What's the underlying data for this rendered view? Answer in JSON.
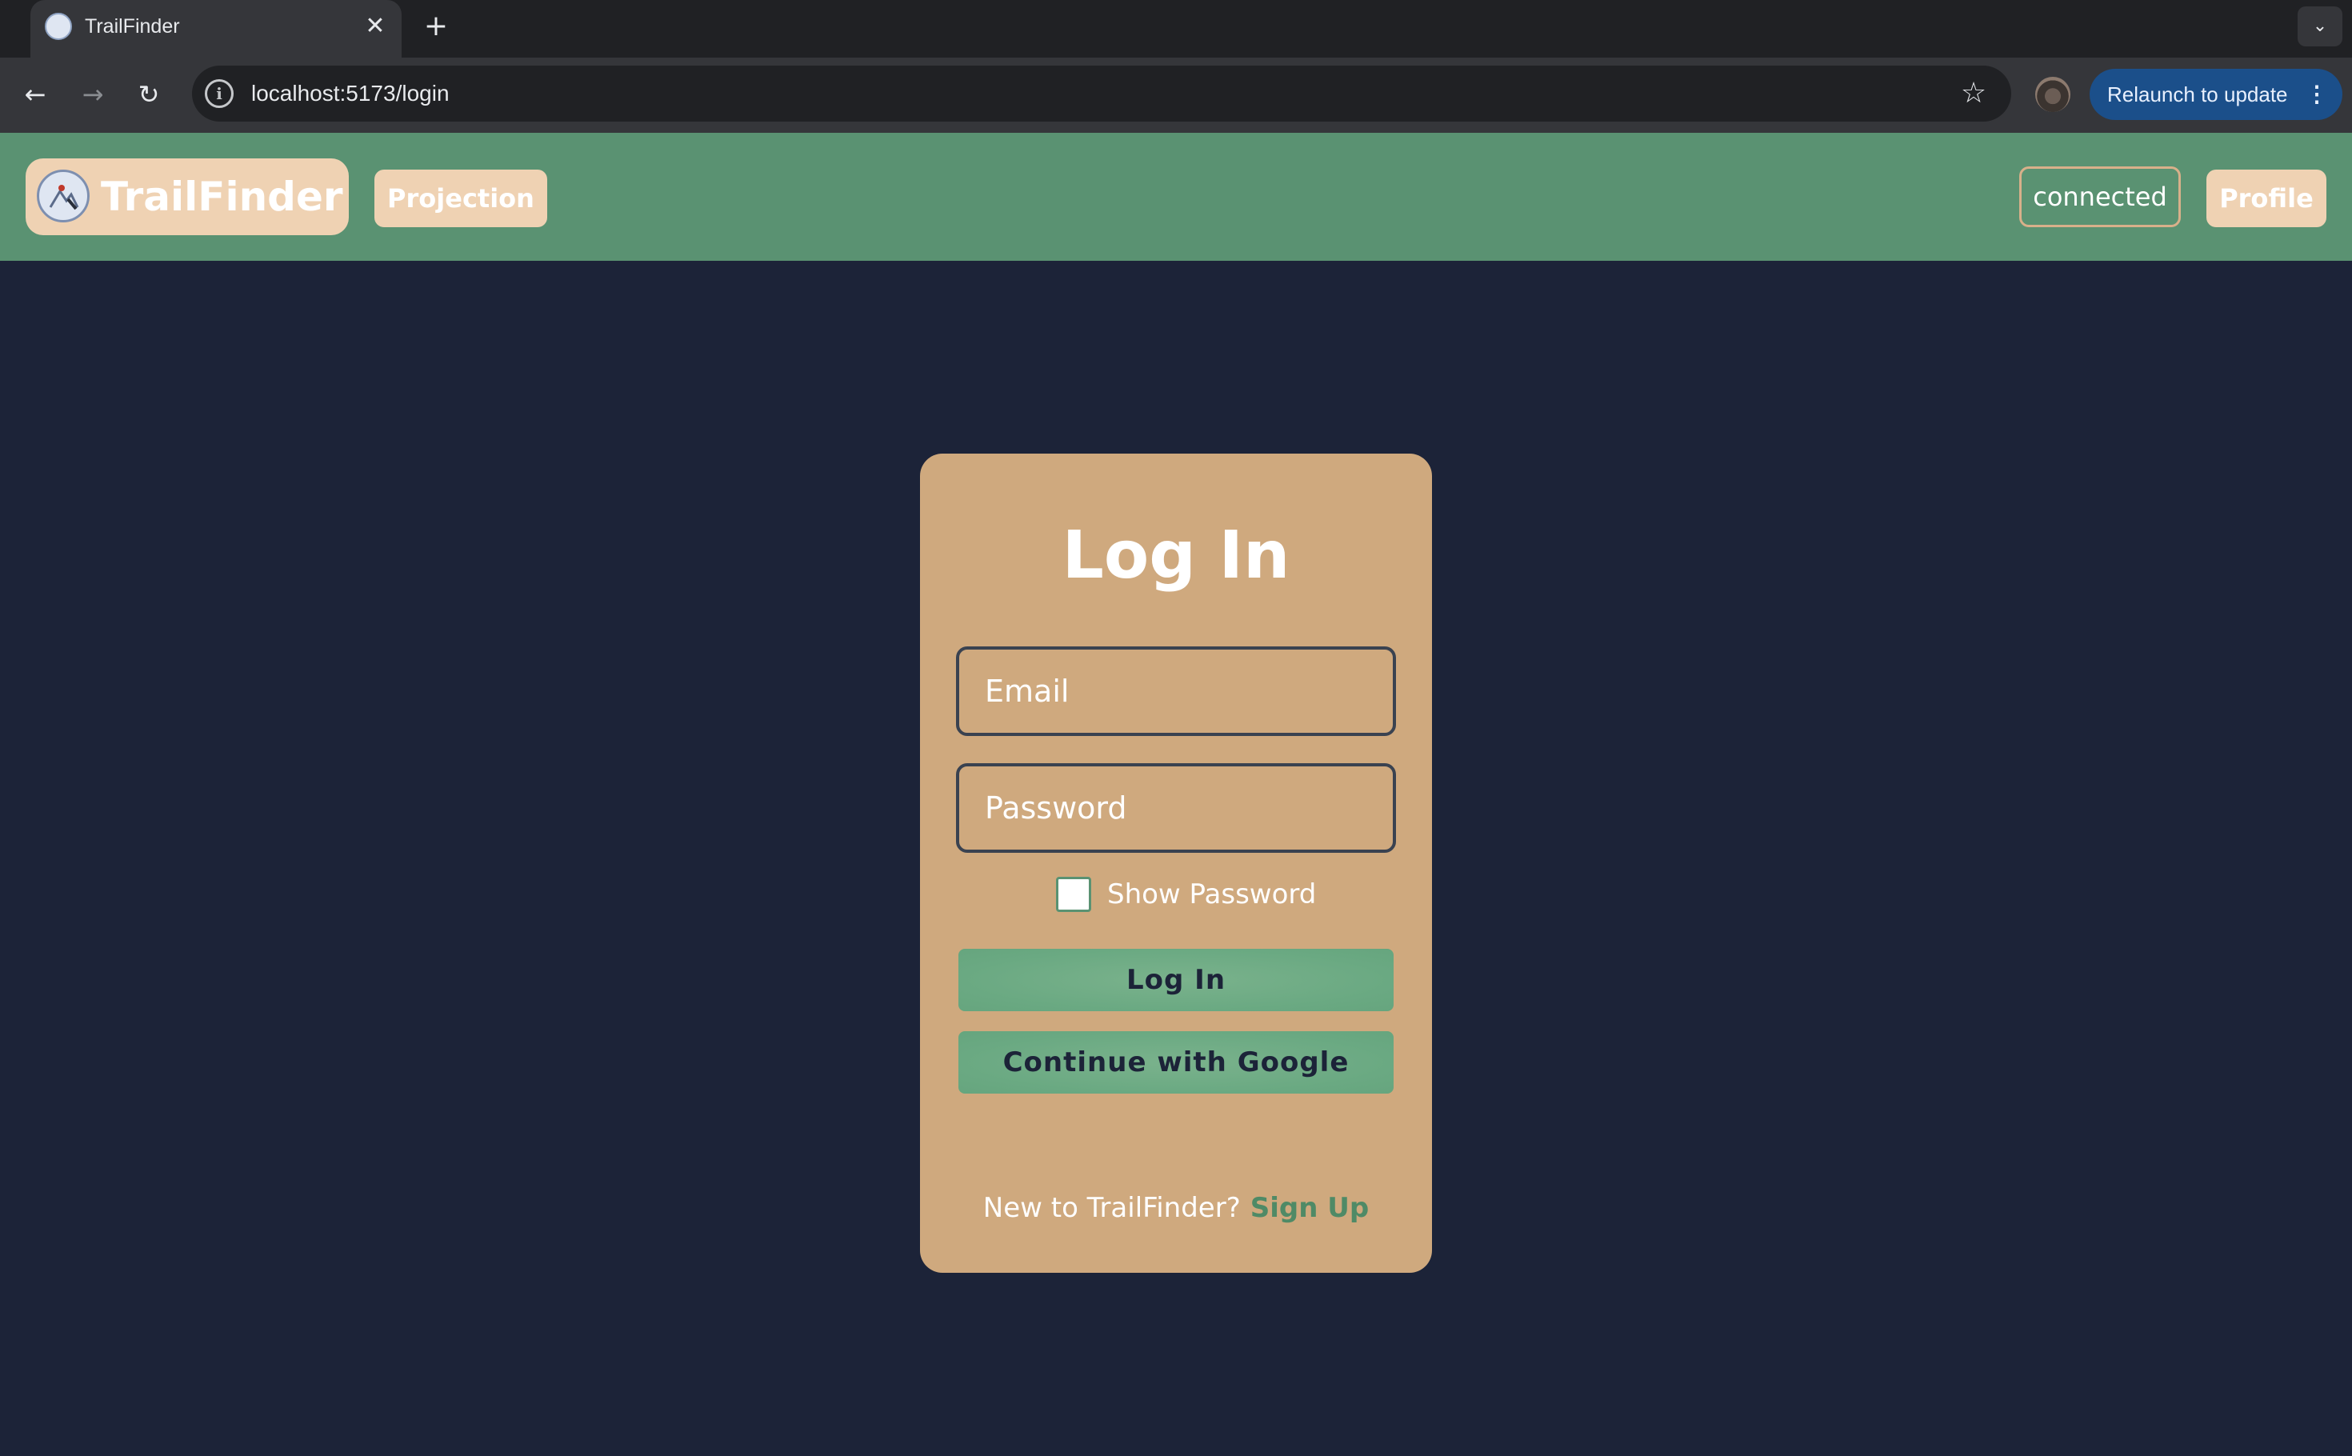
{
  "browser": {
    "tab_title": "TrailFinder",
    "tab_close": "✕",
    "new_tab": "+",
    "tab_search": "⌄",
    "back": "←",
    "forward": "→",
    "reload": "↻",
    "url": "localhost:5173/login",
    "info_icon": "i",
    "star": "☆",
    "relaunch_label": "Relaunch to update",
    "relaunch_menu": "⋮"
  },
  "header": {
    "brand_name": "TrailFinder",
    "nav_projection": "Projection",
    "status": "connected",
    "nav_profile": "Profile",
    "colors": {
      "header_bg": "#5a9272",
      "pill_bg": "#efd2b3"
    }
  },
  "login": {
    "title": "Log In",
    "email_placeholder": "Email",
    "password_placeholder": "Password",
    "show_password_label": "Show Password",
    "show_password_checked": false,
    "login_button": "Log In",
    "google_button": "Continue with Google",
    "signup_prompt": "New to TrailFinder?",
    "signup_link": "Sign Up",
    "colors": {
      "page_bg": "#1c2338",
      "card_bg": "#cfa97e",
      "button_bg": "#6aa982"
    }
  }
}
